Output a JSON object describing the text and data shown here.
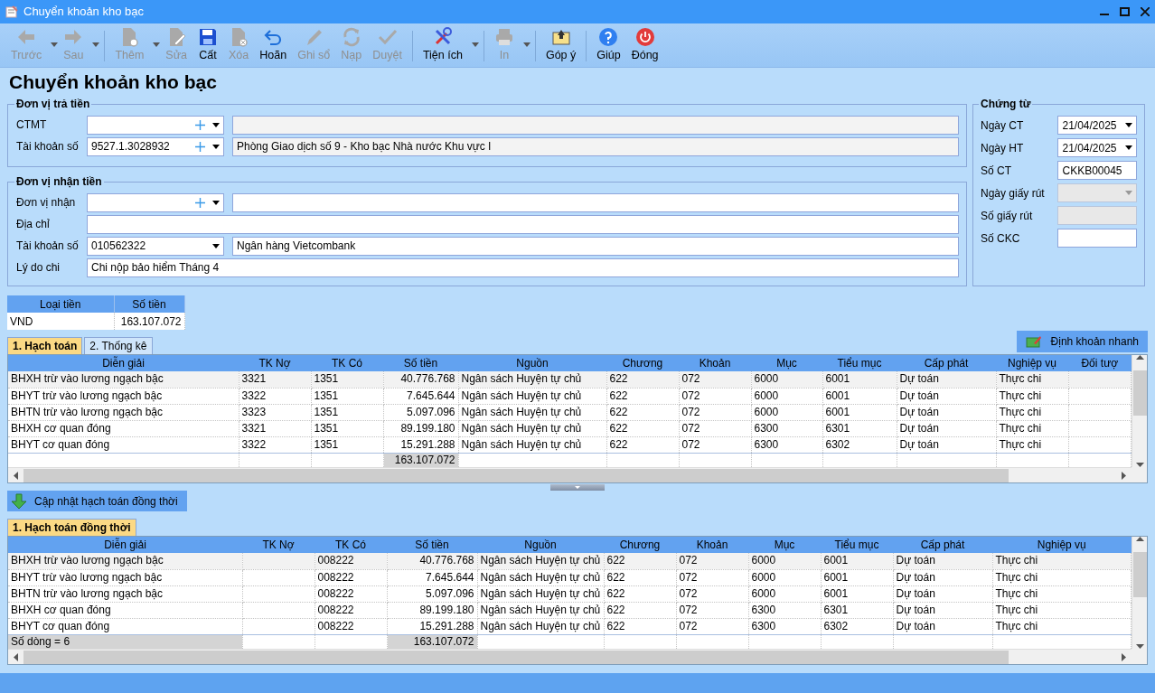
{
  "window": {
    "title": "Chuyển khoản kho bạc"
  },
  "toolbar": [
    {
      "label": "Trước",
      "kind": "back",
      "disabled": true,
      "dropdown": true
    },
    {
      "label": "Sau",
      "kind": "forward",
      "disabled": true,
      "dropdown": true,
      "separator_after": true
    },
    {
      "label": "Thêm",
      "kind": "new",
      "disabled": true,
      "dropdown": true
    },
    {
      "label": "Sửa",
      "kind": "edit",
      "disabled": true
    },
    {
      "label": "Cất",
      "kind": "save",
      "disabled": false
    },
    {
      "label": "Xóa",
      "kind": "delete",
      "disabled": true
    },
    {
      "label": "Hoãn",
      "kind": "undo",
      "disabled": false
    },
    {
      "label": "Ghi sổ",
      "kind": "pencil",
      "disabled": true
    },
    {
      "label": "Nạp",
      "kind": "refresh",
      "disabled": true
    },
    {
      "label": "Duyệt",
      "kind": "check",
      "disabled": true,
      "separator_after": true
    },
    {
      "label": "Tiện ích",
      "kind": "tools",
      "disabled": false,
      "dropdown": true,
      "separator_after": true
    },
    {
      "label": "In",
      "kind": "print",
      "disabled": true,
      "dropdown": true,
      "separator_after": true
    },
    {
      "label": "Góp ý",
      "kind": "feedback",
      "disabled": false,
      "separator_after": true
    },
    {
      "label": "Giúp",
      "kind": "help",
      "disabled": false
    },
    {
      "label": "Đóng",
      "kind": "close",
      "disabled": false
    }
  ],
  "heading": "Chuyển khoản kho bạc",
  "payer": {
    "legend": "Đơn vị trả tiền",
    "rows": [
      {
        "kind": "combo",
        "label": "CTMT",
        "add": true,
        "description_readonly": true
      },
      {
        "kind": "combo",
        "label": "Tài khoản số",
        "value": "9527.1.3028932",
        "add": true,
        "description": "Phòng Giao dịch số 9 - Kho bạc Nhà nước Khu vực I",
        "description_readonly": true
      }
    ]
  },
  "receiver": {
    "legend": "Đơn vị nhận tiền",
    "rows": [
      {
        "kind": "combo",
        "label": "Đơn vị nhận",
        "add": true,
        "description_readonly": false
      },
      {
        "kind": "text",
        "label": "Địa chỉ"
      },
      {
        "kind": "combo",
        "label": "Tài khoản số",
        "value": "010562322",
        "add": false,
        "description": "Ngân hàng Vietcombank",
        "description_readonly": false
      },
      {
        "kind": "text",
        "label": "Lý do chi",
        "value": "Chi nộp bảo hiểm Tháng 4"
      }
    ]
  },
  "voucher": {
    "legend": "Chứng từ",
    "rows": [
      {
        "kind": "date",
        "label": "Ngày CT",
        "value": "21/04/2025",
        "disabled": false
      },
      {
        "kind": "date",
        "label": "Ngày HT",
        "value": "21/04/2025",
        "disabled": false
      },
      {
        "kind": "text",
        "label": "Số CT",
        "value": "CKKB00045",
        "disabled": false
      },
      {
        "kind": "date",
        "label": "Ngày giấy rút",
        "disabled": true
      },
      {
        "kind": "text",
        "label": "Số giấy rút",
        "disabled": true
      },
      {
        "kind": "text",
        "label": "Số CKC",
        "disabled": false
      }
    ]
  },
  "currency_table": {
    "columns": [
      "Loại tiền",
      "Số tiền"
    ],
    "rows": [
      [
        "VND",
        "163.107.072"
      ]
    ]
  },
  "tabs": [
    {
      "label": "1. Hạch toán",
      "selected": true
    },
    {
      "label": "2. Thống kê",
      "selected": false
    }
  ],
  "quick_entry_button": "Định khoản nhanh",
  "grid_1": {
    "columns": [
      {
        "label": "Diễn giải"
      },
      {
        "label": "TK Nợ"
      },
      {
        "label": "TK Có"
      },
      {
        "label": "Số tiền",
        "numeric": true
      },
      {
        "label": "Nguồn"
      },
      {
        "label": "Chương"
      },
      {
        "label": "Khoản"
      },
      {
        "label": "Mục"
      },
      {
        "label": "Tiểu mục"
      },
      {
        "label": "Cấp phát"
      },
      {
        "label": "Nghiệp vụ"
      },
      {
        "label": "Đối tượ"
      }
    ],
    "rows": [
      {
        "selected": true,
        "cells": [
          "BHXH trừ vào lương ngạch bậc",
          "3321",
          "1351",
          "40.776.768",
          "Ngân sách Huyện tự chủ",
          "622",
          "072",
          "6000",
          "6001",
          "Dự toán",
          "Thực chi",
          null
        ]
      },
      {
        "selected": false,
        "cells": [
          "BHYT trừ vào lương ngạch bậc",
          "3322",
          "1351",
          "7.645.644",
          "Ngân sách Huyện tự chủ",
          "622",
          "072",
          "6000",
          "6001",
          "Dự toán",
          "Thực chi",
          null
        ]
      },
      {
        "selected": false,
        "cells": [
          "BHTN trừ vào lương ngạch bậc",
          "3323",
          "1351",
          "5.097.096",
          "Ngân sách Huyện tự chủ",
          "622",
          "072",
          "6000",
          "6001",
          "Dự toán",
          "Thực chi",
          null
        ]
      },
      {
        "selected": false,
        "cells": [
          "BHXH cơ quan đóng",
          "3321",
          "1351",
          "89.199.180",
          "Ngân sách Huyện tự chủ",
          "622",
          "072",
          "6300",
          "6301",
          "Dự toán",
          "Thực chi",
          null
        ]
      },
      {
        "selected": false,
        "cells": [
          "BHYT cơ quan đóng",
          "3322",
          "1351",
          "15.291.288",
          "Ngân sách Huyện tự chủ",
          "622",
          "072",
          "6300",
          "6302",
          "Dự toán",
          "Thực chi",
          null
        ]
      }
    ],
    "footer": {
      "amount": "163.107.072"
    }
  },
  "update_button": "Cập nhật hạch toán đồng thời",
  "tabs_2": [
    {
      "label": "1. Hạch toán đồng thời",
      "selected": true
    }
  ],
  "grid_2": {
    "columns": [
      {
        "label": "Diễn giải"
      },
      {
        "label": "TK Nợ"
      },
      {
        "label": "TK Có"
      },
      {
        "label": "Số tiền",
        "numeric": true
      },
      {
        "label": "Nguồn"
      },
      {
        "label": "Chương"
      },
      {
        "label": "Khoản"
      },
      {
        "label": "Mục"
      },
      {
        "label": "Tiểu mục"
      },
      {
        "label": "Cấp phát"
      },
      {
        "label": "Nghiệp vụ"
      }
    ],
    "rows": [
      {
        "selected": true,
        "cells": [
          "BHXH trừ vào lương ngạch bậc",
          null,
          "008222",
          "40.776.768",
          "Ngân sách Huyện tự chủ",
          "622",
          "072",
          "6000",
          "6001",
          "Dự toán",
          "Thực chi"
        ]
      },
      {
        "selected": false,
        "cells": [
          "BHYT trừ vào lương ngạch bậc",
          null,
          "008222",
          "7.645.644",
          "Ngân sách Huyện tự chủ",
          "622",
          "072",
          "6000",
          "6001",
          "Dự toán",
          "Thực chi"
        ]
      },
      {
        "selected": false,
        "cells": [
          "BHTN trừ vào lương ngạch bậc",
          null,
          "008222",
          "5.097.096",
          "Ngân sách Huyện tự chủ",
          "622",
          "072",
          "6000",
          "6001",
          "Dự toán",
          "Thực chi"
        ]
      },
      {
        "selected": false,
        "cells": [
          "BHXH cơ quan đóng",
          null,
          "008222",
          "89.199.180",
          "Ngân sách Huyện tự chủ",
          "622",
          "072",
          "6300",
          "6301",
          "Dự toán",
          "Thực chi"
        ]
      },
      {
        "selected": false,
        "cells": [
          "BHYT cơ quan đóng",
          null,
          "008222",
          "15.291.288",
          "Ngân sách Huyện tự chủ",
          "622",
          "072",
          "6300",
          "6302",
          "Dự toán",
          "Thực chi"
        ]
      }
    ],
    "footer": {
      "row_count": "Số dòng = 6",
      "amount": "163.107.072"
    }
  }
}
